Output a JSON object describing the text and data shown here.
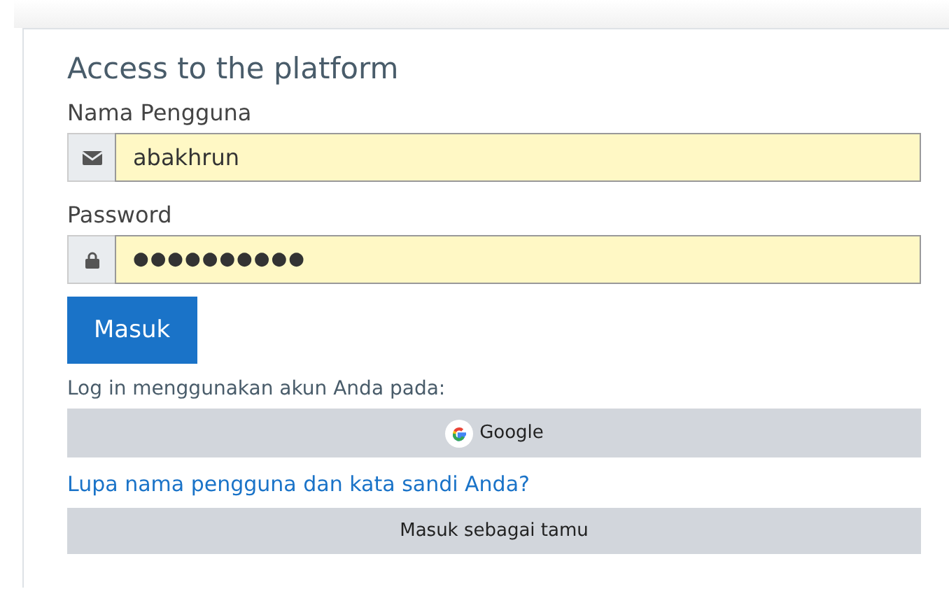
{
  "heading": "Access to the platform",
  "fields": [
    {
      "label": "Nama Pengguna",
      "kind": "user",
      "value": "abakhrun"
    },
    {
      "label": "Password",
      "kind": "password",
      "value": "●●●●●●●●●●"
    }
  ],
  "login_button": "Masuk",
  "sso_prompt": "Log in menggunakan akun Anda pada:",
  "sso_button": "Google",
  "forgot_link": "Lupa nama pengguna dan kata sandi Anda?",
  "guest_button": "Masuk sebagai tamu"
}
